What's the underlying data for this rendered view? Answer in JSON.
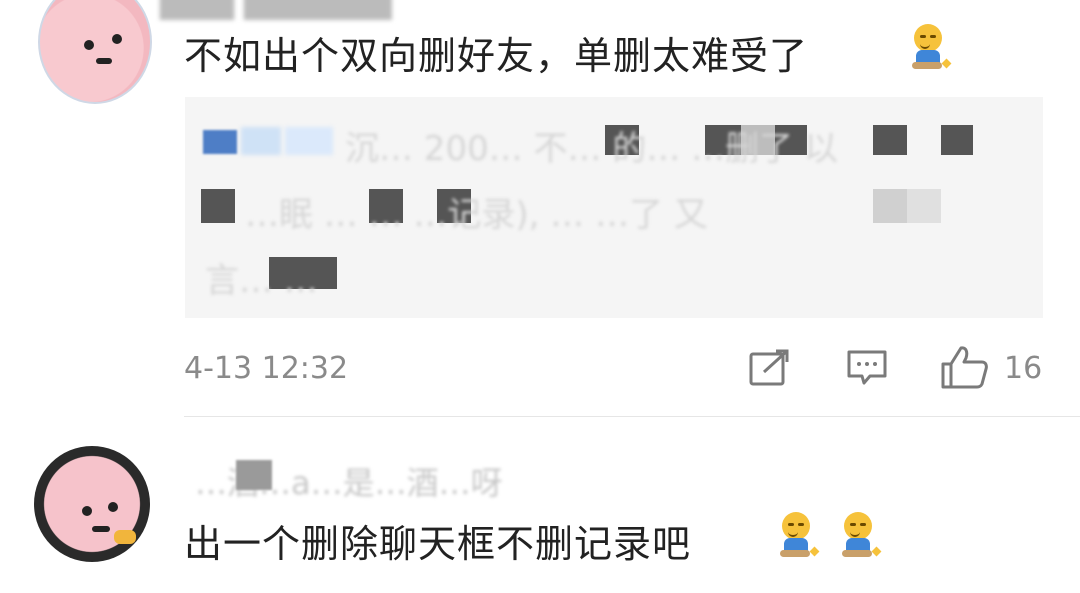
{
  "comments": [
    {
      "text": "不如出个双向删好友，单删太难受了",
      "emoji": [
        "smirk-sitting-emoji"
      ],
      "quote": {
        "blurred_lines": [
          "沉… 200… 不… 的… …删了 以",
          "…眠 …  … …记录), … …了 又",
          "言… …"
        ]
      },
      "timestamp": "4-13 12:32",
      "like_count": "16"
    },
    {
      "username": "…酒…a…是…酒…呀",
      "text": "出一个删除聊天框不删记录吧",
      "emoji": [
        "smirk-sitting-emoji",
        "smirk-sitting-emoji"
      ]
    }
  ],
  "colors": {
    "text": "#222222",
    "meta": "#8a8a8a",
    "quote_bg": "#f5f5f5",
    "divider": "#e6e6e6"
  },
  "icons": [
    "share-icon",
    "comment-icon",
    "like-icon"
  ]
}
